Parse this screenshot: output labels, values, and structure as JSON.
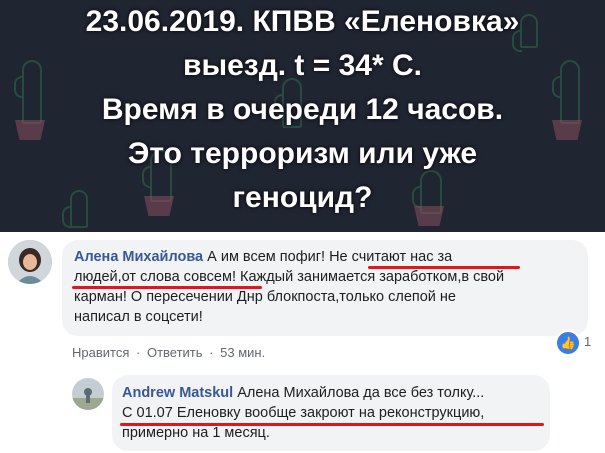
{
  "banner": {
    "lines": [
      "23.06.2019. КПВВ «Еленовка»",
      "выезд. t = 34* С.",
      "Время в очереди 12 часов.",
      "Это терроризм или уже",
      "геноцид?"
    ]
  },
  "comment": {
    "author": "Алена Михайлова",
    "text_lines": [
      " А им всем пофиг! Не считают нас за",
      "людей,от слова совсем! Каждый занимается заработком,в свой",
      "карман! О пересечении Днр блокпоста,только слепой не",
      "написал в соцсети!"
    ],
    "like_label": "Нравится",
    "reply_label": "Ответить",
    "separator": "·",
    "time": "53 мин.",
    "like_count": "1",
    "like_icon": "thumbs-up-icon"
  },
  "reply": {
    "author": "Andrew Matskul",
    "text_lines": [
      " Алена Михайлова да все без толку...",
      "С 01.07 Еленовку вообще закроют на реконструкцию,",
      "примерно на 1 месяц."
    ]
  },
  "colors": {
    "banner_bg": "#202532",
    "name": "#385898",
    "underline": "#e0161e",
    "like_badge": "#3b7de8"
  }
}
